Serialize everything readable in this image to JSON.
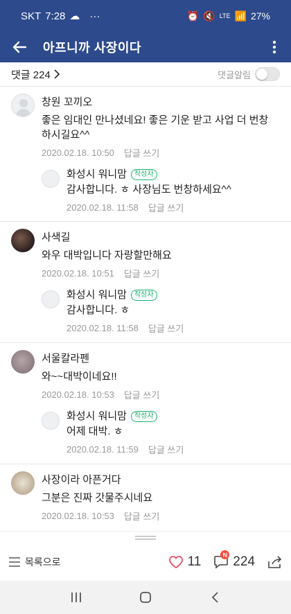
{
  "status": {
    "carrier": "SKT",
    "time": "7:28",
    "battery": "27%",
    "lte": "LTE"
  },
  "app_bar": {
    "title": "아프니까 사장이다"
  },
  "comments_header": {
    "label": "댓글 224",
    "alarm_label": "댓글알림"
  },
  "comments": [
    {
      "author": "창원 꼬끼오",
      "text": "좋은 임대인 만나셨네요! 좋은 기운 받고 사업 더 번창하시길요^^",
      "date": "2020.02.18. 10:50",
      "reply_label": "답글 쓰기",
      "reply": {
        "author": "화성시 워니맘",
        "badge": "작성자",
        "text": "감사합니다. ㅎ 사장님도 번창하세요^^",
        "date": "2020.02.18. 11:58",
        "reply_label": "답글 쓰기"
      }
    },
    {
      "author": "사색길",
      "text": "와우 대박입니다 자랑할만해요",
      "date": "2020.02.18. 10:51",
      "reply_label": "답글 쓰기",
      "reply": {
        "author": "화성시 워니맘",
        "badge": "작성자",
        "text": "감사합니다. ㅎ",
        "date": "2020.02.18. 11:58",
        "reply_label": "답글 쓰기"
      }
    },
    {
      "author": "서울칼라펜",
      "text": "와~~대박이네요!!",
      "date": "2020.02.18. 10:53",
      "reply_label": "답글 쓰기",
      "reply": {
        "author": "화성시 워니맘",
        "badge": "작성자",
        "text": "어제 대박. ㅎ",
        "date": "2020.02.18. 11:59",
        "reply_label": "답글 쓰기"
      }
    },
    {
      "author": "사장이라 아픈거다",
      "text": "그분은 진짜 갓물주시네요",
      "date": "2020.02.18. 10:53",
      "reply_label": "답글 쓰기"
    }
  ],
  "bottom_bar": {
    "list_label": "목록으로",
    "likes": "11",
    "comments": "224",
    "new_badge": "N"
  },
  "colors": {
    "header_bg": "#2d4a8c",
    "badge_green": "#1bb36b",
    "like_red": "#e84a5f",
    "new_badge_red": "#ff4a3a"
  },
  "icons": [
    "back-arrow-icon",
    "more-vertical-icon",
    "chevron-right-icon",
    "list-icon",
    "heart-icon",
    "comment-icon",
    "share-icon",
    "recent-apps-icon",
    "home-icon",
    "nav-back-icon"
  ]
}
